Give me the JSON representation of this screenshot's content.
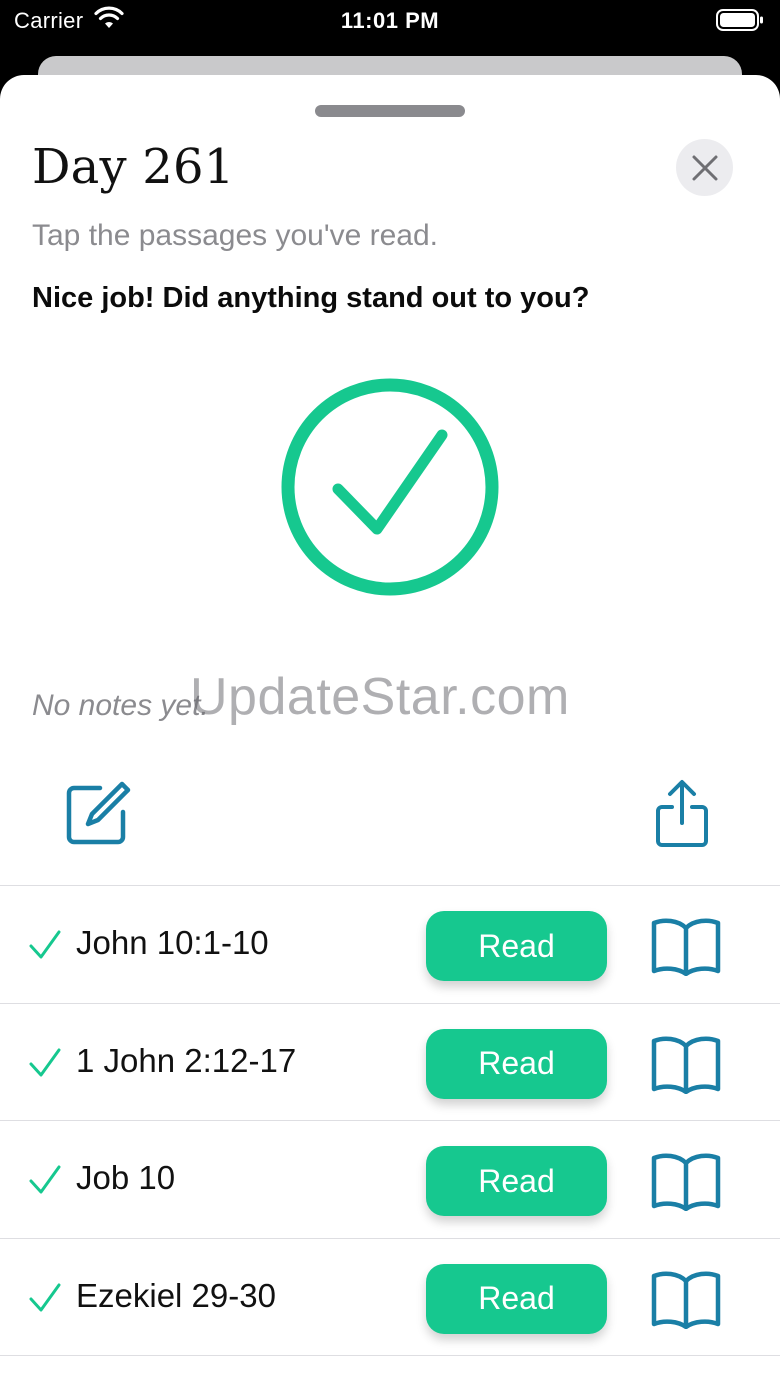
{
  "status_bar": {
    "carrier": "Carrier",
    "time": "11:01 PM"
  },
  "sheet": {
    "title": "Day 261",
    "subtitle": "Tap the passages you've read.",
    "prompt": "Nice job! Did anything stand out to you?",
    "notes_placeholder": "No notes yet.",
    "watermark": "UpdateStar.com"
  },
  "passages": [
    {
      "label": "John 10:1-10",
      "read_label": "Read",
      "completed": true
    },
    {
      "label": "1 John 2:12-17",
      "read_label": "Read",
      "completed": true
    },
    {
      "label": "Job 10",
      "read_label": "Read",
      "completed": true
    },
    {
      "label": "Ezekiel 29-30",
      "read_label": "Read",
      "completed": true
    }
  ],
  "colors": {
    "accent": "#16c88f",
    "icon_teal": "#1a7fa6",
    "text_gray": "#8b8b8f"
  },
  "icons": [
    "wifi-icon",
    "battery-icon",
    "close-icon",
    "checkmark-circle-icon",
    "edit-icon",
    "share-icon",
    "checkmark-icon",
    "book-icon"
  ]
}
